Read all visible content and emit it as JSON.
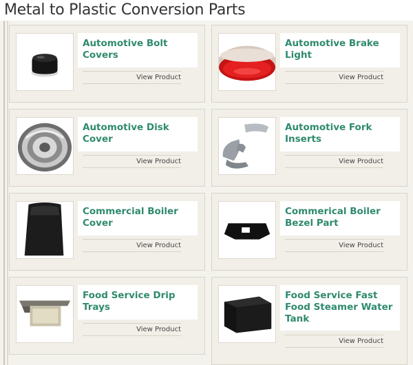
{
  "page": {
    "title": "Metal to Plastic Conversion Parts"
  },
  "products": [
    {
      "name": "Automotive Bolt Covers",
      "link": "View Product",
      "image_icon": "bolt-cover-image"
    },
    {
      "name": "Automotive Brake Light",
      "link": "View Product",
      "image_icon": "brake-light-image"
    },
    {
      "name": "Automotive Disk Cover",
      "link": "View Product",
      "image_icon": "disk-cover-image"
    },
    {
      "name": "Automotive Fork Inserts",
      "link": "View Product",
      "image_icon": "fork-inserts-image"
    },
    {
      "name": "Commercial Boiler Cover",
      "link": "View Product",
      "image_icon": "boiler-cover-image"
    },
    {
      "name": "Commerical Boiler Bezel Part",
      "link": "View Product",
      "image_icon": "boiler-bezel-image"
    },
    {
      "name": "Food Service Drip Trays",
      "link": "View Product",
      "image_icon": "drip-tray-image"
    },
    {
      "name": "Food Service Fast Food Steamer Water Tank",
      "link": "View Product",
      "image_icon": "steamer-tank-image"
    }
  ],
  "colors": {
    "title_green": "#2f8a6e",
    "panel_bg": "#f4f2ec",
    "card_bg": "#f2efe8"
  }
}
